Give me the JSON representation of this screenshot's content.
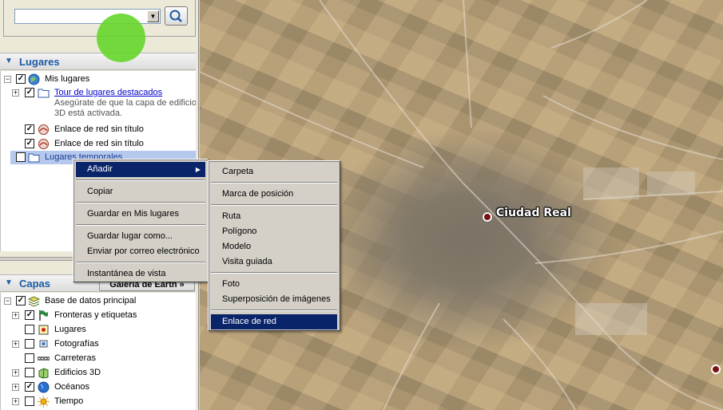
{
  "search": {
    "value": "",
    "dropdown_icon": "chevron-down-icon",
    "button_icon": "magnifier-icon"
  },
  "places": {
    "title": "Lugares",
    "root_label": "Mis lugares",
    "items": [
      {
        "label": "Tour de lugares destacados",
        "checked": true,
        "is_link": true
      },
      {
        "label": "Enlace de red sin título",
        "checked": true
      },
      {
        "label": "Enlace de red sin título",
        "checked": true
      }
    ],
    "tour_description_line1": "Asegúrate de que la capa de edificios",
    "tour_description_line2": "3D está activada.",
    "temporary_label": "Lugares temporales"
  },
  "layers": {
    "title": "Capas",
    "gallery_button": "Galería de Earth »",
    "root_label": "Base de datos principal",
    "items": [
      {
        "label": "Fronteras y etiquetas",
        "checked": true
      },
      {
        "label": "Lugares",
        "checked": false
      },
      {
        "label": "Fotografías",
        "checked": false
      },
      {
        "label": "Carreteras",
        "checked": false
      },
      {
        "label": "Edificios 3D",
        "checked": false
      },
      {
        "label": "Océanos",
        "checked": true
      },
      {
        "label": "Tiempo",
        "checked": false
      }
    ]
  },
  "context_menu": {
    "items": [
      "Añadir",
      "Copiar",
      "Guardar en Mis lugares",
      "Guardar lugar como...",
      "Enviar por correo electrónico",
      "Instantánea de vista"
    ]
  },
  "submenu": {
    "items": [
      "Carpeta",
      "Marca de posición",
      "Ruta",
      "Polígono",
      "Modelo",
      "Visita guiada",
      "Foto",
      "Superposición de imágenes",
      "Enlace de red"
    ],
    "selected": "Enlace de red"
  },
  "map": {
    "city_label": "Ciudad Real"
  },
  "colors": {
    "menu_highlight": "#0a246a",
    "section_title": "#1c5ba6",
    "link": "#0000cc"
  }
}
